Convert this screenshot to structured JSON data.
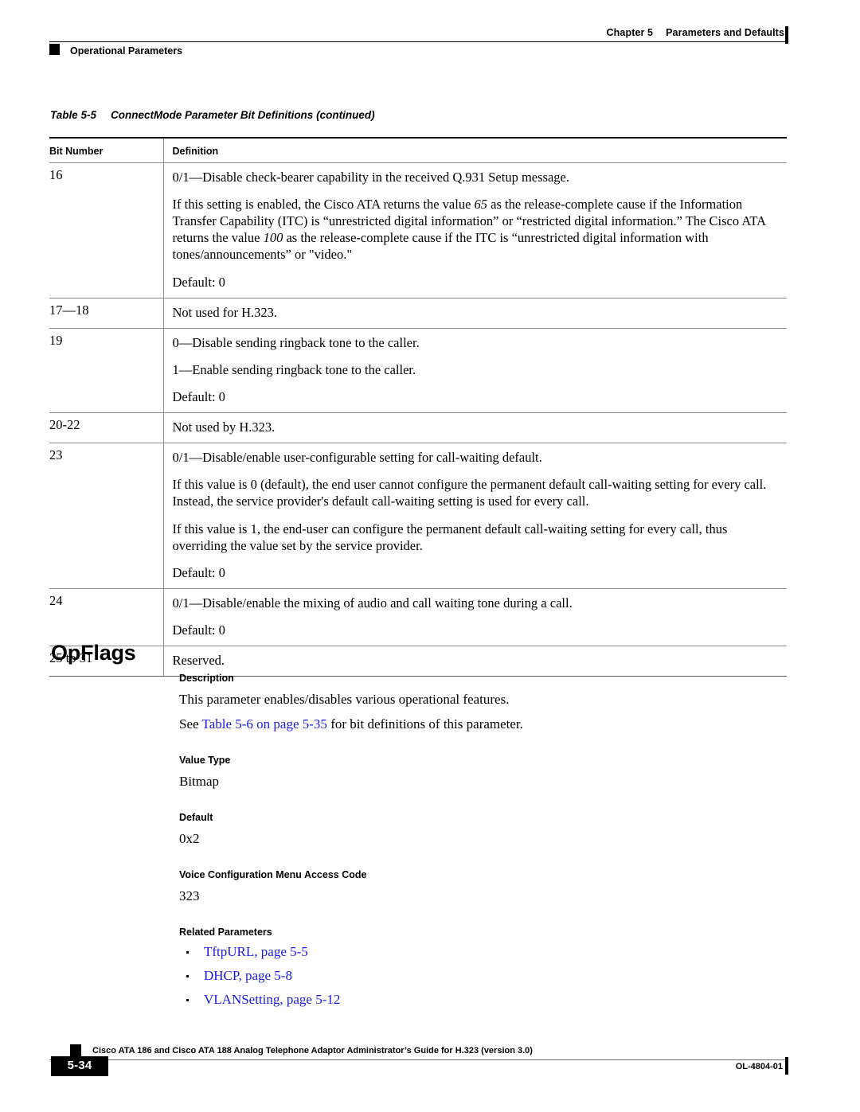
{
  "header": {
    "chapter": "Chapter 5",
    "chapter_title": "Parameters and Defaults",
    "running_head": "Operational Parameters"
  },
  "table": {
    "caption_number": "Table 5-5",
    "caption_title": "ConnectMode Parameter Bit Definitions",
    "caption_continued": "(continued)",
    "columns": [
      "Bit Number",
      "Definition"
    ],
    "rows": [
      {
        "bit": "16",
        "paragraphs": [
          "0/1—Disable check-bearer capability in the received Q.931 Setup message.",
          "If this setting is enabled, the Cisco ATA returns the value 65 as the release-complete cause if the Information Transfer Capability (ITC) is “unrestricted digital information” or “restricted digital information.” The Cisco ATA returns the value 100 as the release-complete cause if the ITC is “unrestricted digital information with tones/announcements” or \"video.\"",
          "Default: 0"
        ]
      },
      {
        "bit": "17—18",
        "paragraphs": [
          "Not used for H.323."
        ]
      },
      {
        "bit": "19",
        "paragraphs": [
          "0—Disable sending ringback tone to the caller.",
          "1—Enable sending ringback tone to the caller.",
          "Default: 0"
        ]
      },
      {
        "bit": "20-22",
        "paragraphs": [
          "Not used by H.323."
        ]
      },
      {
        "bit": "23",
        "paragraphs": [
          "0/1—Disable/enable user-configurable setting for call-waiting default.",
          "If this value is 0 (default), the end user cannot configure the permanent default call-waiting setting for every call. Instead, the service provider's default call-waiting setting is used for every call.",
          "If this value is 1, the end-user can configure the permanent default call-waiting setting for every call, thus overriding the value set by the service provider.",
          "Default: 0"
        ]
      },
      {
        "bit": "24",
        "paragraphs": [
          "0/1—Disable/enable the mixing of audio and call waiting tone during a call.",
          "Default: 0"
        ]
      },
      {
        "bit": "25 to 31",
        "paragraphs": [
          "Reserved."
        ]
      }
    ]
  },
  "section": {
    "title": "OpFlags",
    "description_label": "Description",
    "description_line1": "This parameter enables/disables various operational features.",
    "see_prefix": "See ",
    "see_link": "Table 5-6 on page 5-35",
    "see_suffix": " for bit definitions of this parameter.",
    "value_type_label": "Value Type",
    "value_type": "Bitmap",
    "default_label": "Default",
    "default_value": "0x2",
    "access_code_label": "Voice Configuration Menu Access Code",
    "access_code": "323",
    "related_label": "Related Parameters",
    "related": [
      "TftpURL, page 5-5",
      "DHCP, page 5-8",
      "VLANSetting, page 5-12"
    ]
  },
  "footer": {
    "doc_title": "Cisco ATA 186 and Cisco ATA 188 Analog Telephone Adaptor Administrator’s Guide for H.323 (version 3.0)",
    "page_number": "5-34",
    "doc_id": "OL-4804-01"
  },
  "colors": {
    "link": "#1a1ae6",
    "rule": "#8c8c8c",
    "ink": "#000000"
  }
}
